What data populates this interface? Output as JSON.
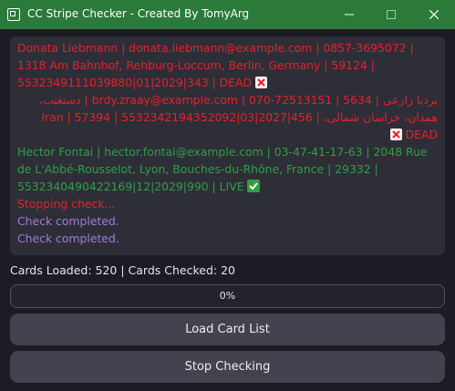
{
  "window": {
    "title": "CC Stripe Checker - Created By TomyArg",
    "title_color": "#2b7a3a"
  },
  "log": {
    "lines": [
      {
        "text": "Donata Liebmann | donata.liebmann@example.com | 0857-3695072 | 1318 Am Bahnhof, Rehburg-Loccum, Berlin, Germany | 59124 | 5532349111039880|01|2029|343 | DEAD",
        "color": "#e8202a",
        "status_icon": "cross-mark-icon"
      },
      {
        "text": "بردیا زارعی | brdy.zraay@example.com | 070-72513151 | 5634 | دستغیب، همدان، خراسان شمالی، Iran | 57394 | 5532342194352092|03|2027|456 | DEAD",
        "color": "#e8202a",
        "status_icon": "cross-mark-icon"
      },
      {
        "text": "Hector Fontai | hector.fontai@example.com | 03-47-41-17-63 | 2048 Rue de L'Abbé-Rousselot, Lyon, Bouches-du-Rhône, France | 29332 | 5532340490422169|12|2029|990 | LIVE",
        "color": "#2ea043",
        "status_icon": "check-mark-icon"
      },
      {
        "text": "Stopping check...",
        "color": "#e8202a"
      },
      {
        "text": "Check completed.",
        "color": "#a37ad6"
      },
      {
        "text": "Check completed.",
        "color": "#a37ad6"
      }
    ]
  },
  "stats": {
    "text": "Cards Loaded: 520 | Cards Checked: 20"
  },
  "progress": {
    "value": 0,
    "label": "0%"
  },
  "buttons": {
    "load": "Load Card List",
    "stop": "Stop Checking"
  }
}
